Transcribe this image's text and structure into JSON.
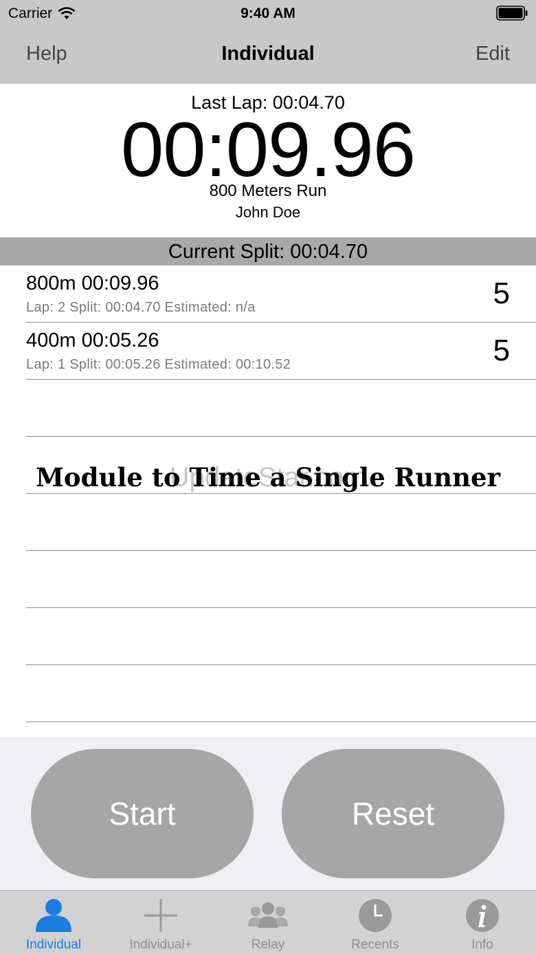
{
  "status_bar": {
    "carrier": "Carrier",
    "time": "9:40 AM"
  },
  "nav": {
    "left": "Help",
    "title": "Individual",
    "right": "Edit"
  },
  "timer": {
    "last_lap": "Last Lap: 00:04.70",
    "elapsed": "00:09.96",
    "event": "800 Meters Run",
    "runner": "John Doe"
  },
  "current_split": "Current Split: 00:04.70",
  "laps": [
    {
      "main": "800m 00:09.96",
      "detail": "Lap: 2  Split: 00:04.70  Estimated: n/a",
      "count": "5"
    },
    {
      "main": "400m 00:05.26",
      "detail": "Lap: 1  Split: 00:05.26  Estimated: 00:10.52",
      "count": "5"
    }
  ],
  "watermark": "UpdateStar.com",
  "caption": "Module to Time a Single Runner",
  "buttons": {
    "start": "Start",
    "reset": "Reset"
  },
  "tabs": [
    {
      "label": "Individual",
      "icon": "person-icon",
      "active": true
    },
    {
      "label": "Individual+",
      "icon": "plus-icon",
      "active": false
    },
    {
      "label": "Relay",
      "icon": "group-icon",
      "active": false
    },
    {
      "label": "Recents",
      "icon": "clock-icon",
      "active": false
    },
    {
      "label": "Info",
      "icon": "info-icon",
      "active": false
    }
  ],
  "colors": {
    "active_tab": "#1a7de0",
    "inactive_tab": "#8f8f8f",
    "button_fill": "#a6a6a6",
    "bars": "#c8c8c8"
  }
}
